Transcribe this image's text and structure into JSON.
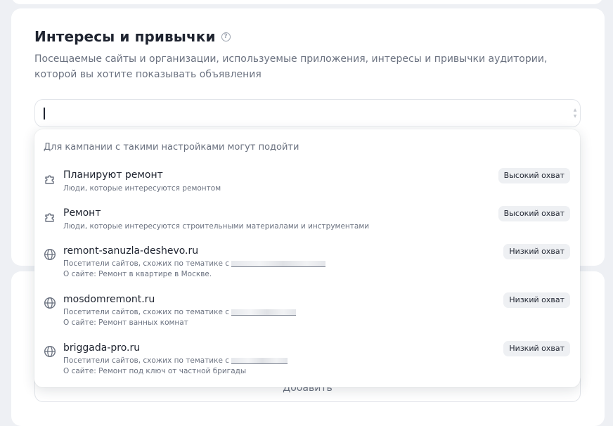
{
  "section": {
    "title": "Интересы и привычки",
    "help_icon": "question-circle-icon",
    "subtitle": "Посещаемые сайты и организации, используемые приложения, интересы и привычки аудитории, которой вы хотите показывать объявления"
  },
  "search": {
    "value": "",
    "placeholder": ""
  },
  "add_button": {
    "label": "Добавить"
  },
  "dropdown": {
    "heading": "Для кампании с такими настройками могут подойти",
    "items": [
      {
        "icon": "puzzle-icon",
        "title": "Планируют ремонт",
        "desc1": "Люди, которые интересуются ремонтом",
        "desc2": "",
        "badge": "Высокий охват"
      },
      {
        "icon": "puzzle-icon",
        "title": "Ремонт",
        "desc1": "Люди, которые интересуются строительными материалами и инструментами",
        "desc2": "",
        "badge": "Высокий охват"
      },
      {
        "icon": "globe-icon",
        "title": "remont-sanuzla-deshevo.ru",
        "desc1": "Посетители сайтов, схожих по тематике с",
        "desc2": "О сайте: Ремонт в квартире в Москве.",
        "badge": "Низкий охват"
      },
      {
        "icon": "globe-icon",
        "title": "mosdomremont.ru",
        "desc1": "Посетители сайтов, схожих по тематике с",
        "desc2": "О сайте: Ремонт ванных комнат",
        "badge": "Низкий охват"
      },
      {
        "icon": "globe-icon",
        "title": "briggada-pro.ru",
        "desc1": "Посетители сайтов, схожих по тематике с",
        "desc2": "О сайте: Ремонт под ключ от частной бригады",
        "badge": "Низкий охват"
      }
    ]
  }
}
